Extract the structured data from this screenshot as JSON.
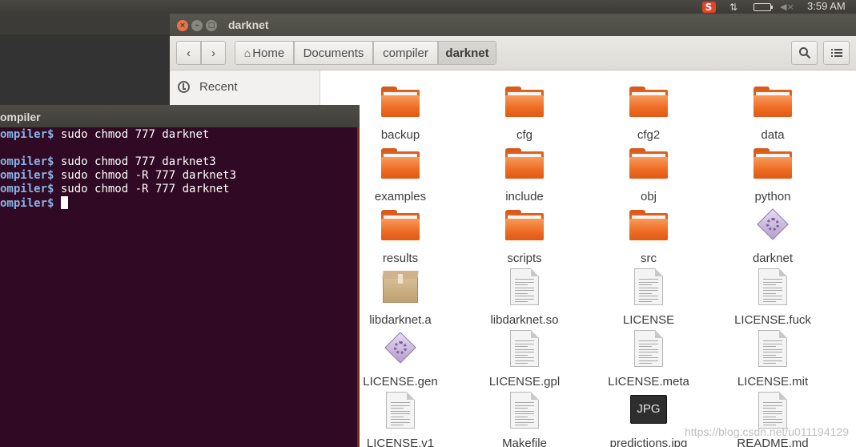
{
  "top_panel": {
    "tray_icons": [
      "sogou-input-icon",
      "network-icon",
      "battery-icon",
      "sound-muted-icon"
    ],
    "sogou_label": "S",
    "clock": "3:59 AM"
  },
  "file_manager": {
    "title": "darknet",
    "breadcrumbs": [
      "Home",
      "Documents",
      "compiler",
      "darknet"
    ],
    "active_breadcrumb": "darknet",
    "sidebar": {
      "items": [
        {
          "label": "Recent",
          "icon": "clock-icon"
        }
      ]
    },
    "files": [
      {
        "name": "backup",
        "type": "folder"
      },
      {
        "name": "cfg",
        "type": "folder"
      },
      {
        "name": "cfg2",
        "type": "folder"
      },
      {
        "name": "data",
        "type": "folder"
      },
      {
        "name": "examples",
        "type": "folder"
      },
      {
        "name": "include",
        "type": "folder"
      },
      {
        "name": "obj",
        "type": "folder"
      },
      {
        "name": "python",
        "type": "folder"
      },
      {
        "name": "results",
        "type": "folder"
      },
      {
        "name": "scripts",
        "type": "folder"
      },
      {
        "name": "src",
        "type": "folder"
      },
      {
        "name": "darknet",
        "type": "executable"
      },
      {
        "name": "libdarknet.a",
        "type": "archive"
      },
      {
        "name": "libdarknet.so",
        "type": "document"
      },
      {
        "name": "LICENSE",
        "type": "document"
      },
      {
        "name": "LICENSE.fuck",
        "type": "document"
      },
      {
        "name": "LICENSE.gen",
        "type": "executable"
      },
      {
        "name": "LICENSE.gpl",
        "type": "document"
      },
      {
        "name": "LICENSE.meta",
        "type": "document"
      },
      {
        "name": "LICENSE.mit",
        "type": "document"
      },
      {
        "name": "LICENSE.v1",
        "type": "document"
      },
      {
        "name": "Makefile",
        "type": "document"
      },
      {
        "name": "predictions.jpg",
        "type": "image",
        "thumb_label": "JPG"
      },
      {
        "name": "README.md",
        "type": "document"
      }
    ],
    "watermark": "https://blog.csdn.net/u011194129"
  },
  "terminal": {
    "title": "ompiler",
    "lines": [
      {
        "prompt": "ompiler$",
        "command": " sudo chmod 777 darknet"
      },
      {
        "prompt": "",
        "command": ""
      },
      {
        "prompt": "ompiler$",
        "command": " sudo chmod 777 darknet3"
      },
      {
        "prompt": "ompiler$",
        "command": " sudo chmod -R 777 darknet3"
      },
      {
        "prompt": "ompiler$",
        "command": " sudo chmod -R 777 darknet"
      },
      {
        "prompt": "ompiler$",
        "command": " "
      }
    ]
  },
  "colors": {
    "terminal_bg": "#300a24",
    "prompt": "#8ab3e6",
    "folder_orange": "#ee6b22",
    "panel": "#3c3b37"
  }
}
